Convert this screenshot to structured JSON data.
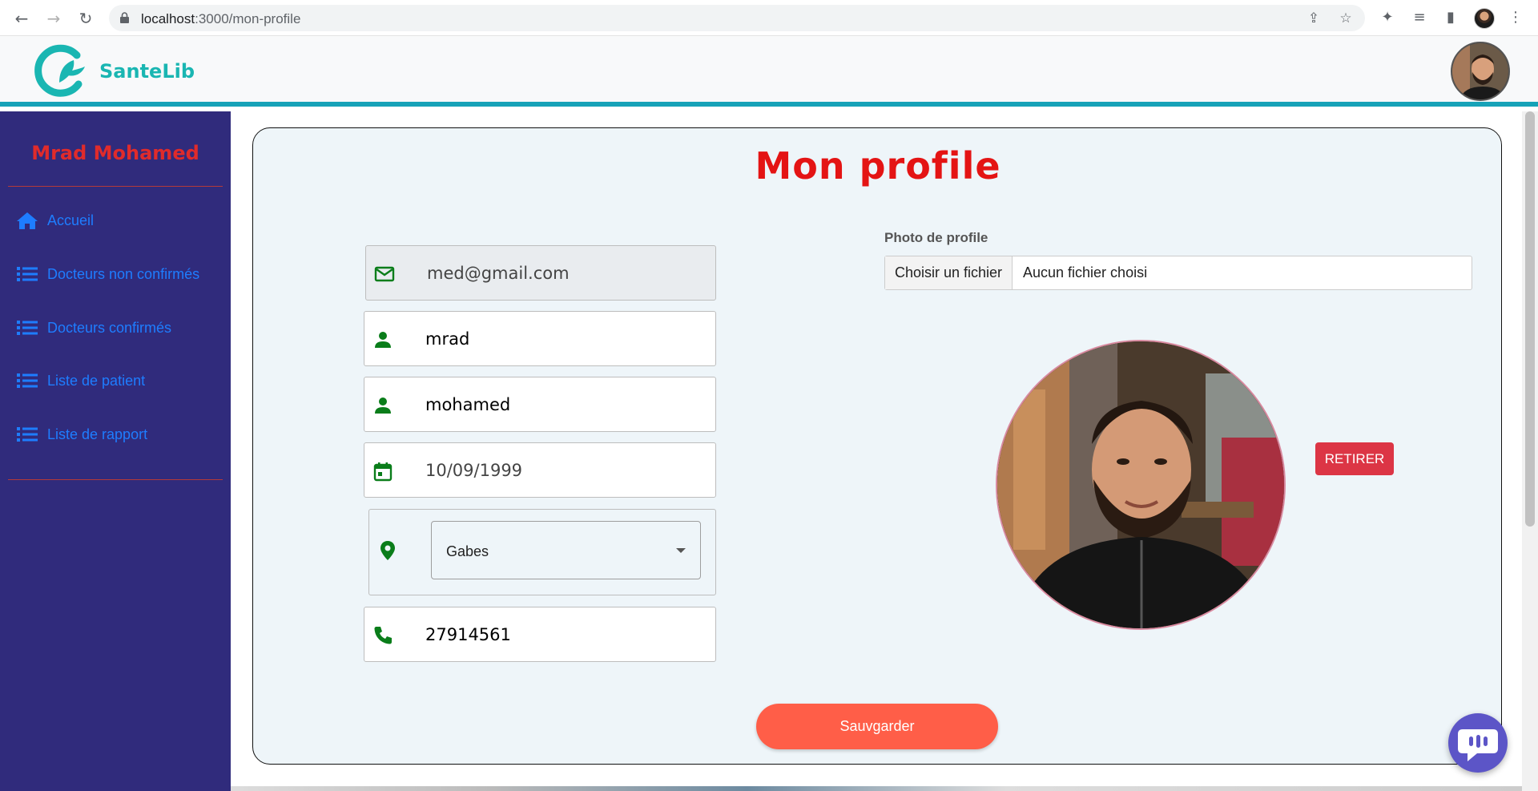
{
  "browser": {
    "url_host": "localhost",
    "url_path": ":3000/mon-profile"
  },
  "header": {
    "brand": "SanteLib"
  },
  "sidebar": {
    "user_name": "Mrad Mohamed",
    "items": [
      {
        "label": "Accueil",
        "icon": "home-icon"
      },
      {
        "label": "Docteurs non confirmés",
        "icon": "list-icon"
      },
      {
        "label": "Docteurs confirmés",
        "icon": "list-icon"
      },
      {
        "label": "Liste de patient",
        "icon": "list-icon"
      },
      {
        "label": "Liste de rapport",
        "icon": "list-icon"
      }
    ]
  },
  "profile": {
    "title": "Mon profile",
    "email": "med@gmail.com",
    "last_name": "mrad",
    "first_name": "mohamed",
    "birth_date": "10/09/1999",
    "city": "Gabes",
    "phone": "27914561",
    "photo_label": "Photo de profile",
    "file_button": "Choisir un fichier",
    "file_status": "Aucun fichier choisi",
    "remove_button": "RETIRER",
    "save_button": "Sauvgarder"
  },
  "colors": {
    "sidebar_bg": "#302b7c",
    "accent_teal": "#17a2b8",
    "title_red": "#e41414",
    "icon_green": "#0a7d1a",
    "save_orange": "#ff5e48",
    "remove_red": "#dc3545"
  }
}
